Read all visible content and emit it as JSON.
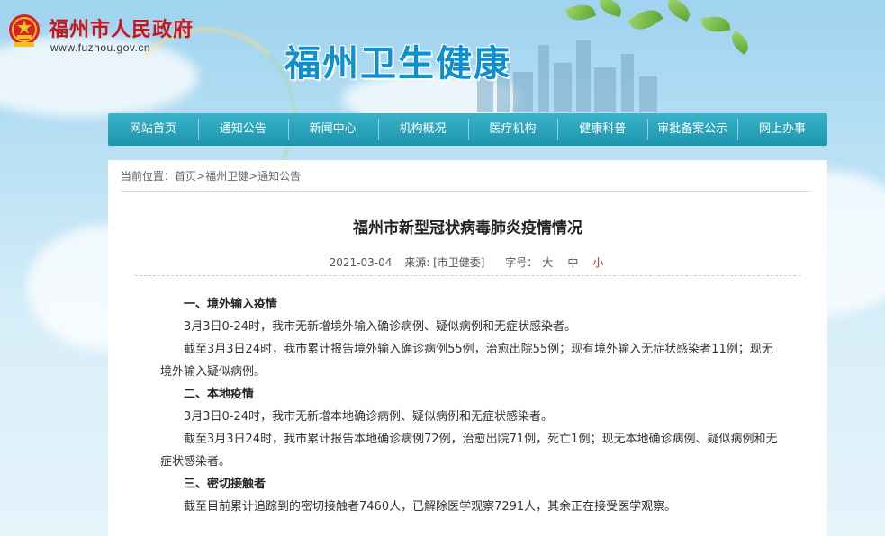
{
  "header": {
    "gov_title": "福州市人民政府",
    "gov_url": "www.fuzhou.gov.cn",
    "site_title": "福州卫生健康"
  },
  "nav": {
    "items": [
      "网站首页",
      "通知公告",
      "新闻中心",
      "机构概况",
      "医疗机构",
      "健康科普",
      "审批备案公示",
      "网上办事"
    ]
  },
  "breadcrumb": {
    "prefix": "当前位置：",
    "items": [
      "首页",
      "福州卫健",
      "通知公告"
    ],
    "sep": ">"
  },
  "article": {
    "title": "福州市新型冠状病毒肺炎疫情情况",
    "date": "2021-03-04",
    "source": "来源: [市卫健委]",
    "font_size_label": "字号：",
    "font_sizes": [
      "大",
      "中",
      "小"
    ],
    "sections": [
      {
        "heading": "一、境外输入疫情",
        "paragraphs": [
          "3月3日0-24时，我市无新增境外输入确诊病例、疑似病例和无症状感染者。",
          "截至3月3日24时，我市累计报告境外输入确诊病例55例，治愈出院55例；现有境外输入无症状感染者11例；现无境外输入疑似病例。"
        ]
      },
      {
        "heading": "二、本地疫情",
        "paragraphs": [
          "3月3日0-24时，我市无新增本地确诊病例、疑似病例和无症状感染者。",
          "截至3月3日24时，我市累计报告本地确诊病例72例，治愈出院71例，死亡1例；现无本地确诊病例、疑似病例和无症状感染者。"
        ]
      },
      {
        "heading": "三、密切接触者",
        "paragraphs": [
          "截至目前累计追踪到的密切接触者7460人，已解除医学观察7291人，其余正在接受医学观察。"
        ]
      }
    ]
  },
  "colors": {
    "nav_bg": "#1d95ad",
    "gov_title": "#c8161d",
    "site_title": "#0d8fd0",
    "size_small_active": "#d2282e"
  }
}
